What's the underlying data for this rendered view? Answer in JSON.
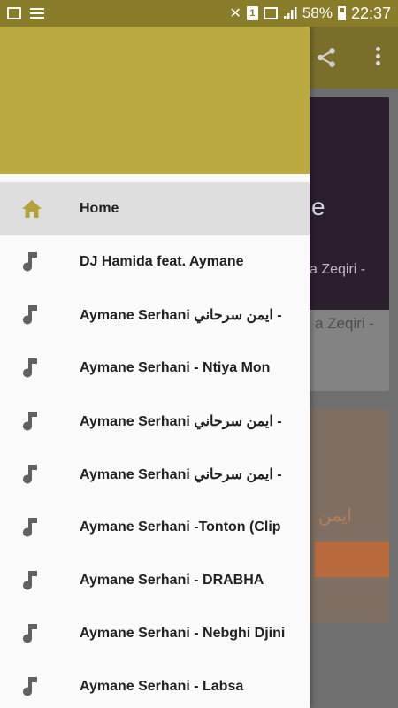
{
  "status_bar": {
    "battery_percent": "58%",
    "time": "22:37",
    "sim_slot": "1"
  },
  "drawer": {
    "items": [
      {
        "label": "Home",
        "icon": "home-icon",
        "active": true
      },
      {
        "label": "DJ Hamida feat. Aymane",
        "icon": "music-note-icon"
      },
      {
        "label": "Aymane Serhani ايمن سرحاني -",
        "icon": "music-note-icon"
      },
      {
        "label": "Aymane Serhani - Ntiya Mon",
        "icon": "music-note-icon"
      },
      {
        "label": "Aymane Serhani ايمن سرحاني -",
        "icon": "music-note-icon"
      },
      {
        "label": "Aymane Serhani ايمن سرحاني -",
        "icon": "music-note-icon"
      },
      {
        "label": "Aymane Serhani -Tonton (Clip",
        "icon": "music-note-icon"
      },
      {
        "label": "Aymane Serhani - DRABHA",
        "icon": "music-note-icon"
      },
      {
        "label": "Aymane Serhani - Nebghi Djini",
        "icon": "music-note-icon"
      },
      {
        "label": "Aymane Serhani - Labsa",
        "icon": "music-note-icon"
      }
    ]
  },
  "background": {
    "card1_title_fragment": "e",
    "card1_subtitle_fragment": "a Zeqiri -",
    "card1_text_fragment": "a Zeqiri -",
    "card2_text_fragment": "ايمن"
  },
  "colors": {
    "status_bar": "#8a7d2a",
    "drawer_header": "#bba941",
    "accent_icon": "#b5a13a",
    "note_icon": "#616161",
    "active_row": "#dedede"
  }
}
